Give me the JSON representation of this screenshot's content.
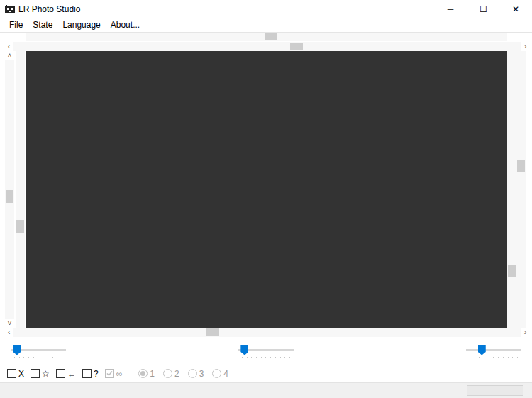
{
  "window": {
    "title": "LR Photo Studio",
    "controls": [
      "─",
      "☐",
      "✕"
    ]
  },
  "menu": [
    {
      "label": "File"
    },
    {
      "label": "State"
    },
    {
      "label": "Language"
    },
    {
      "label": "About..."
    }
  ],
  "scrollbars": {
    "top_outer": {
      "level": 0.51
    },
    "top_inner": {
      "level": 0.56,
      "arrows": [
        "‹",
        "›"
      ]
    },
    "left_outer": {
      "level": 0.53,
      "arrows": [
        "˄",
        "˅"
      ]
    },
    "left_inner": {
      "level": 0.64
    },
    "right_inner": {
      "level": 0.81
    },
    "right_outer": {
      "level": 0.41
    },
    "bottom": {
      "level": 0.39,
      "arrows": [
        "‹",
        "›"
      ]
    }
  },
  "sliders": [
    {
      "level": 0.05
    },
    {
      "level": 0.05
    },
    {
      "level": 0.25
    }
  ],
  "checkboxes": [
    {
      "label": "X",
      "checked": false,
      "disabled": false
    },
    {
      "label": "☆",
      "checked": false,
      "disabled": false
    },
    {
      "label": "←",
      "checked": false,
      "disabled": false
    },
    {
      "label": "?",
      "checked": false,
      "disabled": false
    },
    {
      "label": "∞",
      "checked": true,
      "disabled": true
    }
  ],
  "radios": [
    {
      "label": "1",
      "selected": true,
      "disabled": true
    },
    {
      "label": "2",
      "selected": false,
      "disabled": true
    },
    {
      "label": "3",
      "selected": false,
      "disabled": true
    },
    {
      "label": "4",
      "selected": false,
      "disabled": true
    }
  ]
}
